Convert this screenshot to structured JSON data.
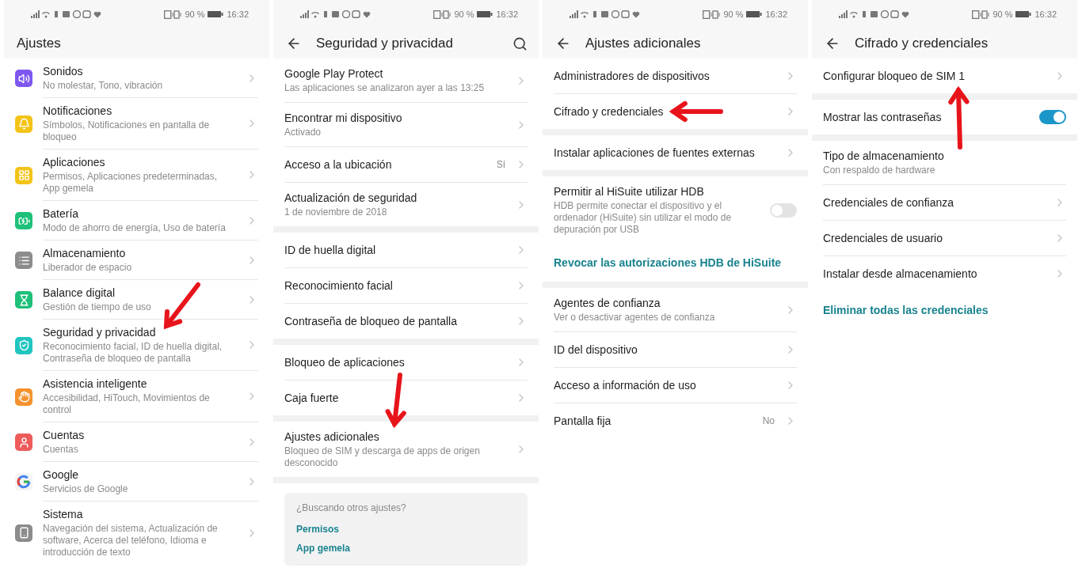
{
  "panels": [
    {
      "status": {
        "battery": "90 %",
        "time": "16:32"
      },
      "title": "Ajustes",
      "back": false,
      "search": false,
      "groups": [
        {
          "items": [
            {
              "kind": "nav",
              "title": "Sonidos",
              "subtitle": "No molestar, Tono, vibración",
              "color": "#7e57f0"
            },
            {
              "kind": "nav",
              "title": "Notificaciones",
              "subtitle": "Símbolos, Notificaciones en pantalla de bloqueo",
              "color": "#f3c316"
            },
            {
              "kind": "nav",
              "title": "Aplicaciones",
              "subtitle": "Permisos, Aplicaciones predeterminadas, App gemela",
              "color": "#f3c316"
            },
            {
              "kind": "nav",
              "title": "Batería",
              "subtitle": "Modo de ahorro de energía, Uso de batería",
              "color": "#1ec07a"
            },
            {
              "kind": "nav",
              "title": "Almacenamiento",
              "subtitle": "Liberador de espacio",
              "color": "#8c8c8c"
            },
            {
              "kind": "nav",
              "title": "Balance digital",
              "subtitle": "Gestión de tiempo de uso",
              "color": "#1ec07a"
            },
            {
              "kind": "nav",
              "title": "Seguridad y privacidad",
              "subtitle": "Reconocimiento facial, ID de huella digital, Contraseña de bloqueo de pantalla",
              "color": "#20c4c0"
            },
            {
              "kind": "nav",
              "title": "Asistencia inteligente",
              "subtitle": "Accesibilidad, HiTouch, Movimientos de control",
              "color": "#f5922e"
            },
            {
              "kind": "nav",
              "title": "Cuentas",
              "subtitle": "Cuentas",
              "color": "#ee5b5b"
            },
            {
              "kind": "nav",
              "title": "Google",
              "subtitle": "Servicios de Google",
              "color": "#4285f4"
            },
            {
              "kind": "nav",
              "title": "Sistema",
              "subtitle": "Navegación del sistema, Actualización de software, Acerca del teléfono, Idioma e introducción de texto",
              "color": "#8c8c8c"
            }
          ]
        }
      ]
    },
    {
      "status": {
        "battery": "90 %",
        "time": "16:32"
      },
      "title": "Seguridad y privacidad",
      "back": true,
      "search": true,
      "groups": [
        {
          "items": [
            {
              "kind": "nav",
              "title": "Google Play Protect",
              "subtitle": "Las aplicaciones se analizaron ayer a las 13:25"
            },
            {
              "kind": "nav",
              "title": "Encontrar mi dispositivo",
              "subtitle": "Activado"
            },
            {
              "kind": "value",
              "title": "Acceso a la ubicación",
              "value": "Sí"
            },
            {
              "kind": "nav",
              "title": "Actualización de seguridad",
              "subtitle": "1 de noviembre de 2018"
            }
          ]
        },
        {
          "items": [
            {
              "kind": "nav",
              "title": "ID de huella digital"
            },
            {
              "kind": "nav",
              "title": "Reconocimiento facial"
            },
            {
              "kind": "nav",
              "title": "Contraseña de bloqueo de pantalla"
            }
          ]
        },
        {
          "items": [
            {
              "kind": "nav",
              "title": "Bloqueo de aplicaciones"
            },
            {
              "kind": "nav",
              "title": "Caja fuerte"
            }
          ]
        },
        {
          "items": [
            {
              "kind": "nav",
              "title": "Ajustes adicionales",
              "subtitle": "Bloqueo de SIM y descarga de apps de origen desconocido"
            }
          ]
        }
      ],
      "suggestions": {
        "title": "¿Buscando otros ajustes?",
        "links": [
          "Permisos",
          "App gemela"
        ]
      }
    },
    {
      "status": {
        "battery": "90 %",
        "time": "16:32"
      },
      "title": "Ajustes adicionales",
      "back": true,
      "search": false,
      "groups": [
        {
          "items": [
            {
              "kind": "nav",
              "title": "Administradores de dispositivos"
            },
            {
              "kind": "nav",
              "title": "Cifrado y credenciales"
            }
          ]
        },
        {
          "items": [
            {
              "kind": "nav",
              "title": "Instalar aplicaciones de fuentes externas"
            }
          ]
        },
        {
          "items": [
            {
              "kind": "toggle",
              "title": "Permitir al HiSuite utilizar HDB",
              "subtitle": "HDB permite conectar el dispositivo y el ordenador (HiSuite) sin utilizar el modo de depuración por USB",
              "on": false
            },
            {
              "kind": "link",
              "title": "Revocar las autorizaciones HDB de HiSuite"
            }
          ]
        },
        {
          "items": [
            {
              "kind": "nav",
              "title": "Agentes de confianza",
              "subtitle": "Ver o desactivar agentes de confianza"
            },
            {
              "kind": "nav",
              "title": "ID del dispositivo"
            },
            {
              "kind": "nav",
              "title": "Acceso a información de uso"
            },
            {
              "kind": "value",
              "title": "Pantalla fija",
              "value": "No"
            }
          ]
        }
      ]
    },
    {
      "status": {
        "battery": "90 %",
        "time": "16:32"
      },
      "title": "Cifrado y credenciales",
      "back": true,
      "search": false,
      "groups": [
        {
          "items": [
            {
              "kind": "nav",
              "title": "Configurar bloqueo de SIM 1"
            }
          ]
        },
        {
          "items": [
            {
              "kind": "toggle",
              "title": "Mostrar las contraseñas",
              "on": true
            }
          ]
        },
        {
          "items": [
            {
              "kind": "text",
              "title": "Tipo de almacenamiento",
              "subtitle": "Con respaldo de hardware"
            },
            {
              "kind": "nav",
              "title": "Credenciales de confianza"
            },
            {
              "kind": "nav",
              "title": "Credenciales de usuario"
            },
            {
              "kind": "nav",
              "title": "Instalar desde almacenamiento"
            },
            {
              "kind": "link",
              "title": "Eliminar todas las credenciales"
            }
          ]
        }
      ]
    }
  ]
}
